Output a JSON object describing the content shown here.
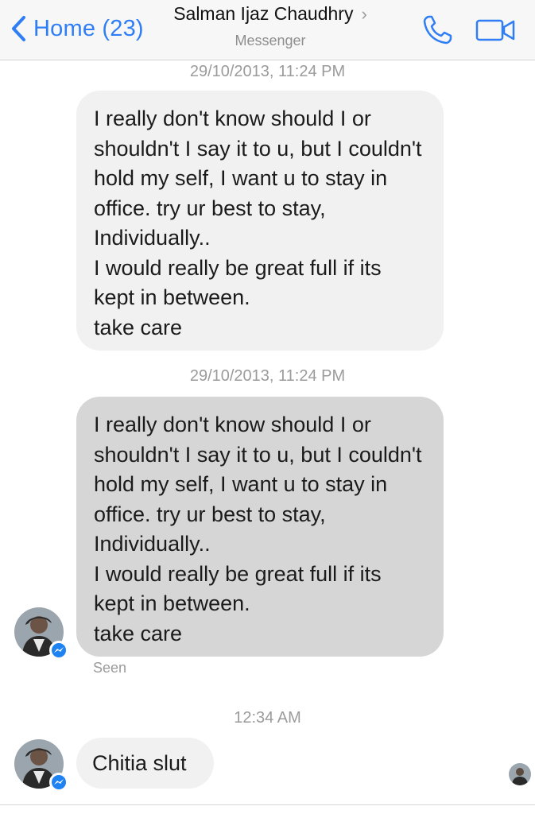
{
  "header": {
    "back_label": "Home (23)",
    "contact_name": "Salman Ijaz Chaudhry",
    "subtitle": "Messenger",
    "accent_color": "#2f7ef6"
  },
  "conversation": {
    "timestamps": [
      "29/10/2013, 11:24 PM",
      "29/10/2013, 11:24 PM",
      "12:34 AM"
    ],
    "messages": [
      {
        "text": "I really don't know should I or shouldn't I say it to u, but I couldn't hold my self, I want u to stay in office. try ur best to stay, Individually..\nI would really be great full if its kept in between.\ntake care"
      },
      {
        "text": "I really don't know should I or shouldn't I say it to u, but I couldn't hold my self, I want u to stay in office. try ur best to stay, Individually..\nI would really be great full if its kept in between.\ntake care"
      },
      {
        "text": "Chitia slut"
      }
    ],
    "seen_label": "Seen"
  },
  "icons": {
    "back": "chevron-left-icon",
    "call": "phone-icon",
    "video": "video-camera-icon",
    "badge": "messenger-badge-icon"
  }
}
